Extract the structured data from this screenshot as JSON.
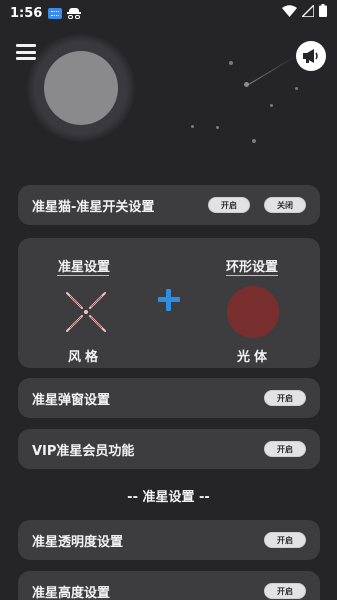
{
  "status_bar": {
    "time": "1:56"
  },
  "header": {},
  "master_switch": {
    "label": "准星猫-准星开关设置",
    "on_label": "开启",
    "off_label": "关闭"
  },
  "crosshair_panel": {
    "left_title": "准星设置",
    "right_title": "环形设置",
    "left_caption": "风格",
    "right_caption": "光体",
    "light_color": "#7a2f2f",
    "plus_color": "#2f8ee0"
  },
  "rows": [
    {
      "label": "准星弹窗设置",
      "toggle": "开启"
    },
    {
      "label": "VIP准星会员功能",
      "toggle": "开启"
    }
  ],
  "section_title": "-- 准星设置 --",
  "settings_rows": [
    {
      "label": "准星透明度设置",
      "toggle": "开启"
    },
    {
      "label": "准星高度设置",
      "toggle": "开启"
    }
  ]
}
